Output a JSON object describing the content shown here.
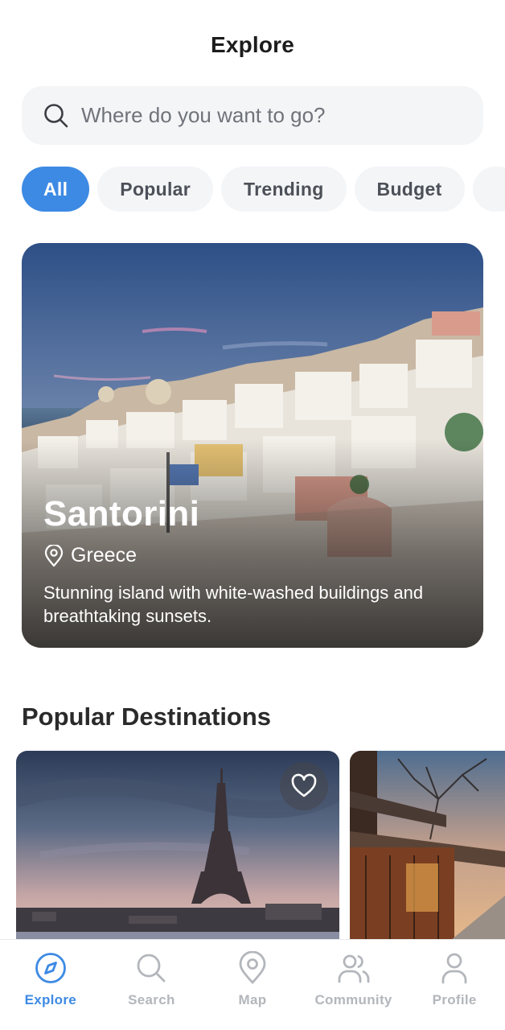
{
  "header": {
    "title": "Explore"
  },
  "search": {
    "placeholder": "Where do you want to go?",
    "icon": "search-icon"
  },
  "filters": [
    {
      "label": "All",
      "active": true
    },
    {
      "label": "Popular",
      "active": false
    },
    {
      "label": "Trending",
      "active": false
    },
    {
      "label": "Budget",
      "active": false
    },
    {
      "label": "",
      "active": false
    }
  ],
  "featured": {
    "title": "Santorini",
    "location": "Greece",
    "location_icon": "map-pin-icon",
    "description": "Stunning island with white-washed buildings and breathtaking sunsets."
  },
  "popular": {
    "title": "Popular Destinations",
    "favorite_icon": "heart-icon"
  },
  "nav": {
    "items": [
      {
        "label": "Explore",
        "icon": "compass-icon",
        "active": true
      },
      {
        "label": "Search",
        "icon": "search-icon",
        "active": false
      },
      {
        "label": "Map",
        "icon": "map-pin-icon",
        "active": false
      },
      {
        "label": "Community",
        "icon": "users-icon",
        "active": false
      },
      {
        "label": "Profile",
        "icon": "user-icon",
        "active": false
      }
    ]
  },
  "colors": {
    "accent": "#3d8ae4",
    "chip_bg": "#f4f5f7",
    "inactive": "#b3b6bb"
  }
}
